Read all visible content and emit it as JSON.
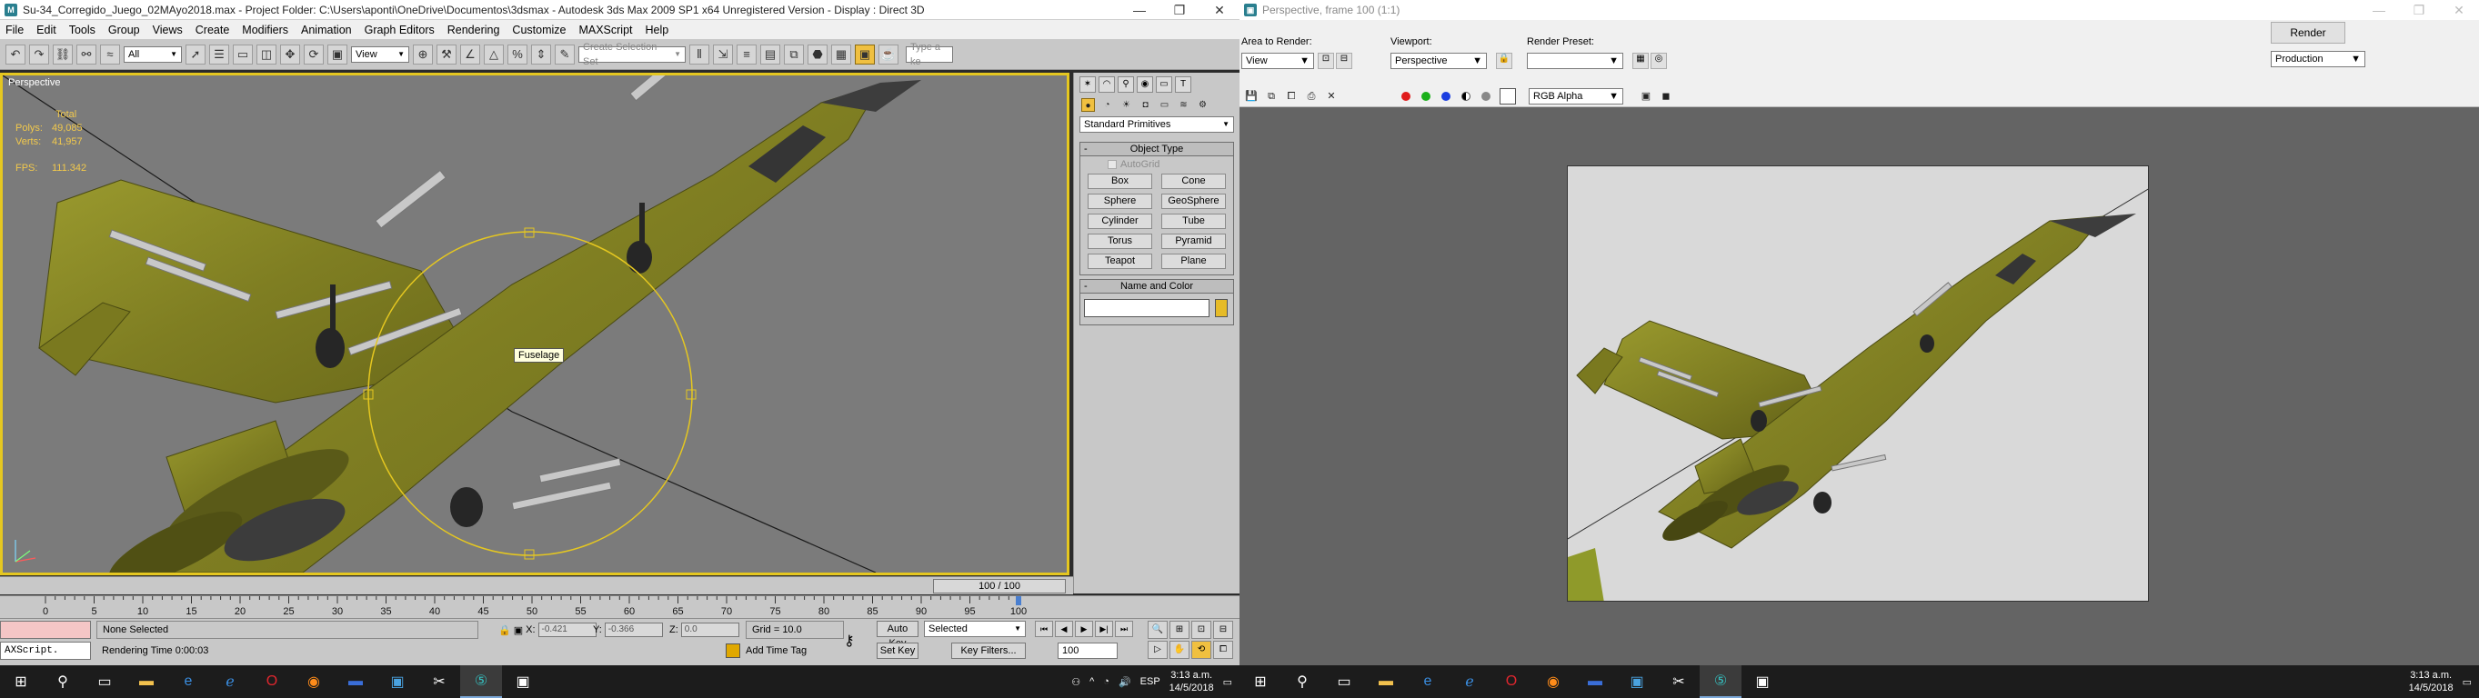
{
  "left": {
    "title": "Su-34_Corregido_Juego_02MAyo2018.max      - Project Folder: C:\\Users\\aponti\\OneDrive\\Documentos\\3dsmax      - Autodesk 3ds Max  2009 SP1  x64    Unregistered Version      - Display : Direct 3D",
    "menu": [
      "File",
      "Edit",
      "Tools",
      "Group",
      "Views",
      "Create",
      "Modifiers",
      "Animation",
      "Graph Editors",
      "Rendering",
      "Customize",
      "MAXScript",
      "Help"
    ],
    "toolbar": {
      "filter": "All",
      "ref_coord": "View",
      "selection_set_placeholder": "Create Selection Set",
      "search_placeholder": "Type a ke"
    },
    "viewport": {
      "label": "Perspective",
      "stats_header": "Total",
      "polys_label": "Polys:",
      "polys_value": "49,085",
      "verts_label": "Verts:",
      "verts_value": "41,957",
      "fps_label": "FPS:",
      "fps_value": "111.342",
      "tooltip": "Fuselage"
    },
    "command_panel": {
      "category": "Standard Primitives",
      "object_type_title": "Object Type",
      "autogrid": "AutoGrid",
      "primitives": [
        "Box",
        "Cone",
        "Sphere",
        "GeoSphere",
        "Cylinder",
        "Tube",
        "Torus",
        "Pyramid",
        "Teapot",
        "Plane"
      ],
      "name_color_title": "Name and Color",
      "color": "#e6bb27"
    },
    "time_slider": "100 / 100",
    "ruler_ticks": [
      "0",
      "5",
      "10",
      "15",
      "20",
      "25",
      "30",
      "35",
      "40",
      "45",
      "50",
      "55",
      "60",
      "65",
      "70",
      "75",
      "80",
      "85",
      "90",
      "95",
      "100"
    ],
    "status": {
      "maxscript": "AXScript.",
      "selection": "None Selected",
      "rendering_time": "Rendering Time  0:00:03",
      "x_label": "X:",
      "x_value": "-0.421",
      "y_label": "Y:",
      "y_value": "-0.366",
      "z_label": "Z:",
      "z_value": "0.0",
      "grid": "Grid = 10.0",
      "add_time_tag": "Add Time Tag",
      "auto_key": "Auto Key",
      "set_key": "Set Key",
      "selected": "Selected",
      "key_filters": "Key Filters...",
      "frame": "100"
    },
    "taskbar": {
      "lang": "ESP",
      "time": "3:13 a.m.",
      "date": "14/5/2018"
    }
  },
  "right": {
    "title": "Perspective, frame 100 (1:1)",
    "area_to_render_label": "Area to Render:",
    "area_to_render": "View",
    "viewport_label": "Viewport:",
    "viewport": "Perspective",
    "render_preset_label": "Render Preset:",
    "render_preset": "",
    "render_button": "Render",
    "production": "Production",
    "channel": "RGB Alpha",
    "taskbar": {
      "time": "3:13 a.m.",
      "date": "14/5/2018"
    }
  }
}
